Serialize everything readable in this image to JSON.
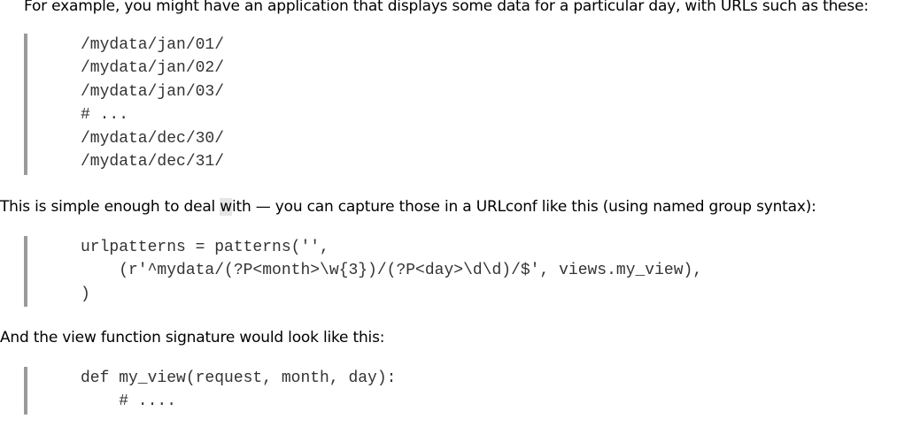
{
  "document": {
    "paragraph_1": "For example, you might have an application that displays some data for a particular day, with URLs such as these:",
    "code_1": [
      "/mydata/jan/01/",
      "/mydata/jan/02/",
      "/mydata/jan/03/",
      "# ...",
      "/mydata/dec/30/",
      "/mydata/dec/31/"
    ],
    "paragraph_2_before": "This is simple enough to deal ",
    "paragraph_2_highlight": "w",
    "paragraph_2_after": "ith — you can capture those in a URLconf like this (using named group syntax):",
    "code_2": [
      "urlpatterns = patterns('',",
      "    (r'^mydata/(?P<month>\\w{3})/(?P<day>\\d\\d)/$', views.my_view),",
      ")"
    ],
    "paragraph_3": "And the view function signature would look like this:",
    "code_3": [
      "def my_view(request, month, day):",
      "    # ...."
    ]
  },
  "colors": {
    "code_text": "#333333",
    "code_border": "#9a9a9a",
    "highlight": "#e6e6e6"
  }
}
